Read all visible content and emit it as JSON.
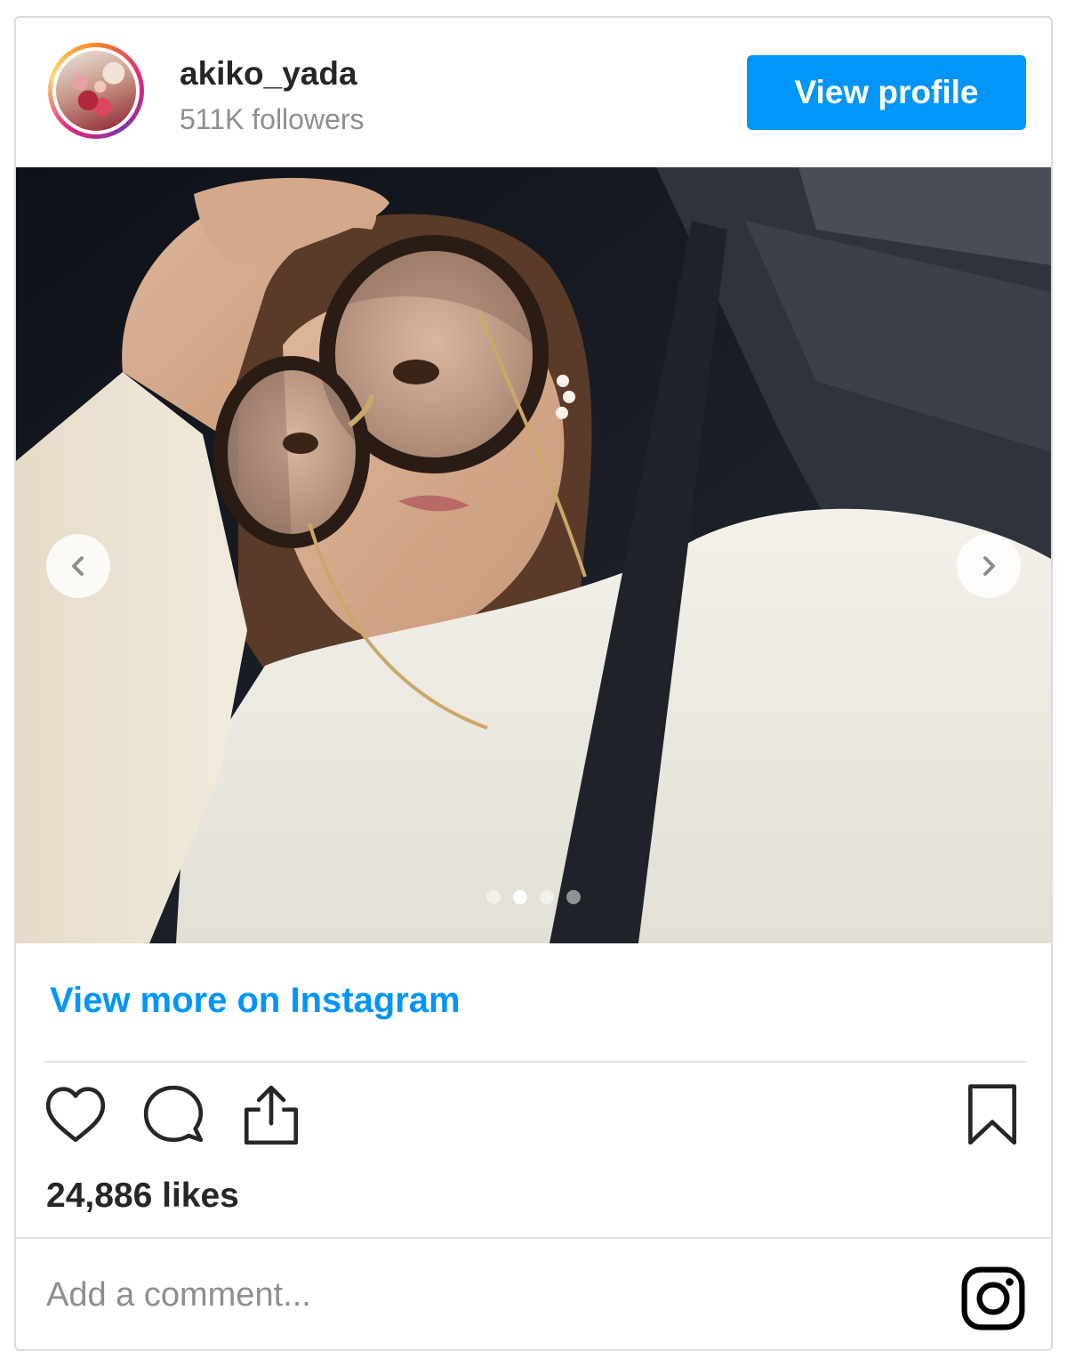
{
  "header": {
    "username": "akiko_yada",
    "followers": "511K followers",
    "view_profile_label": "View profile",
    "avatar_icon": "profile-avatar"
  },
  "post": {
    "carousel": {
      "total_slides": 4,
      "active_slide": 2
    },
    "prev_icon": "chevron-left-icon",
    "next_icon": "chevron-right-icon"
  },
  "view_more_label": "View more on Instagram",
  "actions": {
    "like_icon": "heart-icon",
    "comment_icon": "comment-icon",
    "share_icon": "share-icon",
    "save_icon": "bookmark-icon"
  },
  "likes_text": "24,886 likes",
  "comment_placeholder": "Add a comment...",
  "brand_icon": "instagram-icon",
  "colors": {
    "accent": "#0095f6",
    "text": "#262626",
    "muted": "#8e8e8e",
    "border": "#dbdbdb"
  }
}
